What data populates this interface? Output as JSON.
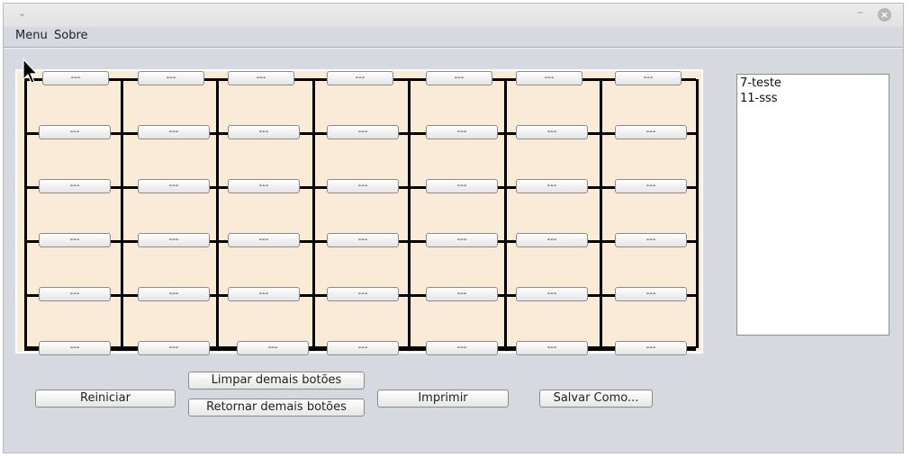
{
  "titlebar": {
    "chevron": "⌄",
    "minimize": "–",
    "close": "×"
  },
  "menubar": {
    "items": [
      "Menu",
      "Sobre"
    ]
  },
  "grid": {
    "cell_color": "#faebd7",
    "rows": [
      [
        "---",
        "---",
        "---",
        "---",
        "---",
        "---",
        "---"
      ],
      [
        "---",
        "---",
        "---",
        "---",
        "---",
        "---",
        "---"
      ],
      [
        "---",
        "---",
        "---",
        "---",
        "---",
        "---",
        "---"
      ],
      [
        "---",
        "---",
        "---",
        "---",
        "---",
        "---",
        "---"
      ],
      [
        "---",
        "---",
        "---",
        "---",
        "---",
        "---",
        "---"
      ],
      [
        "---",
        "---",
        "---",
        "---",
        "---",
        "---",
        "---"
      ]
    ]
  },
  "list": {
    "items": [
      "7-teste",
      "11-sss"
    ]
  },
  "buttons": {
    "reiniciar": "Reiniciar",
    "limpar": "Limpar demais botões",
    "retornar": "Retornar demais botões",
    "imprimir": "Imprimir",
    "salvar": "Salvar Como..."
  }
}
